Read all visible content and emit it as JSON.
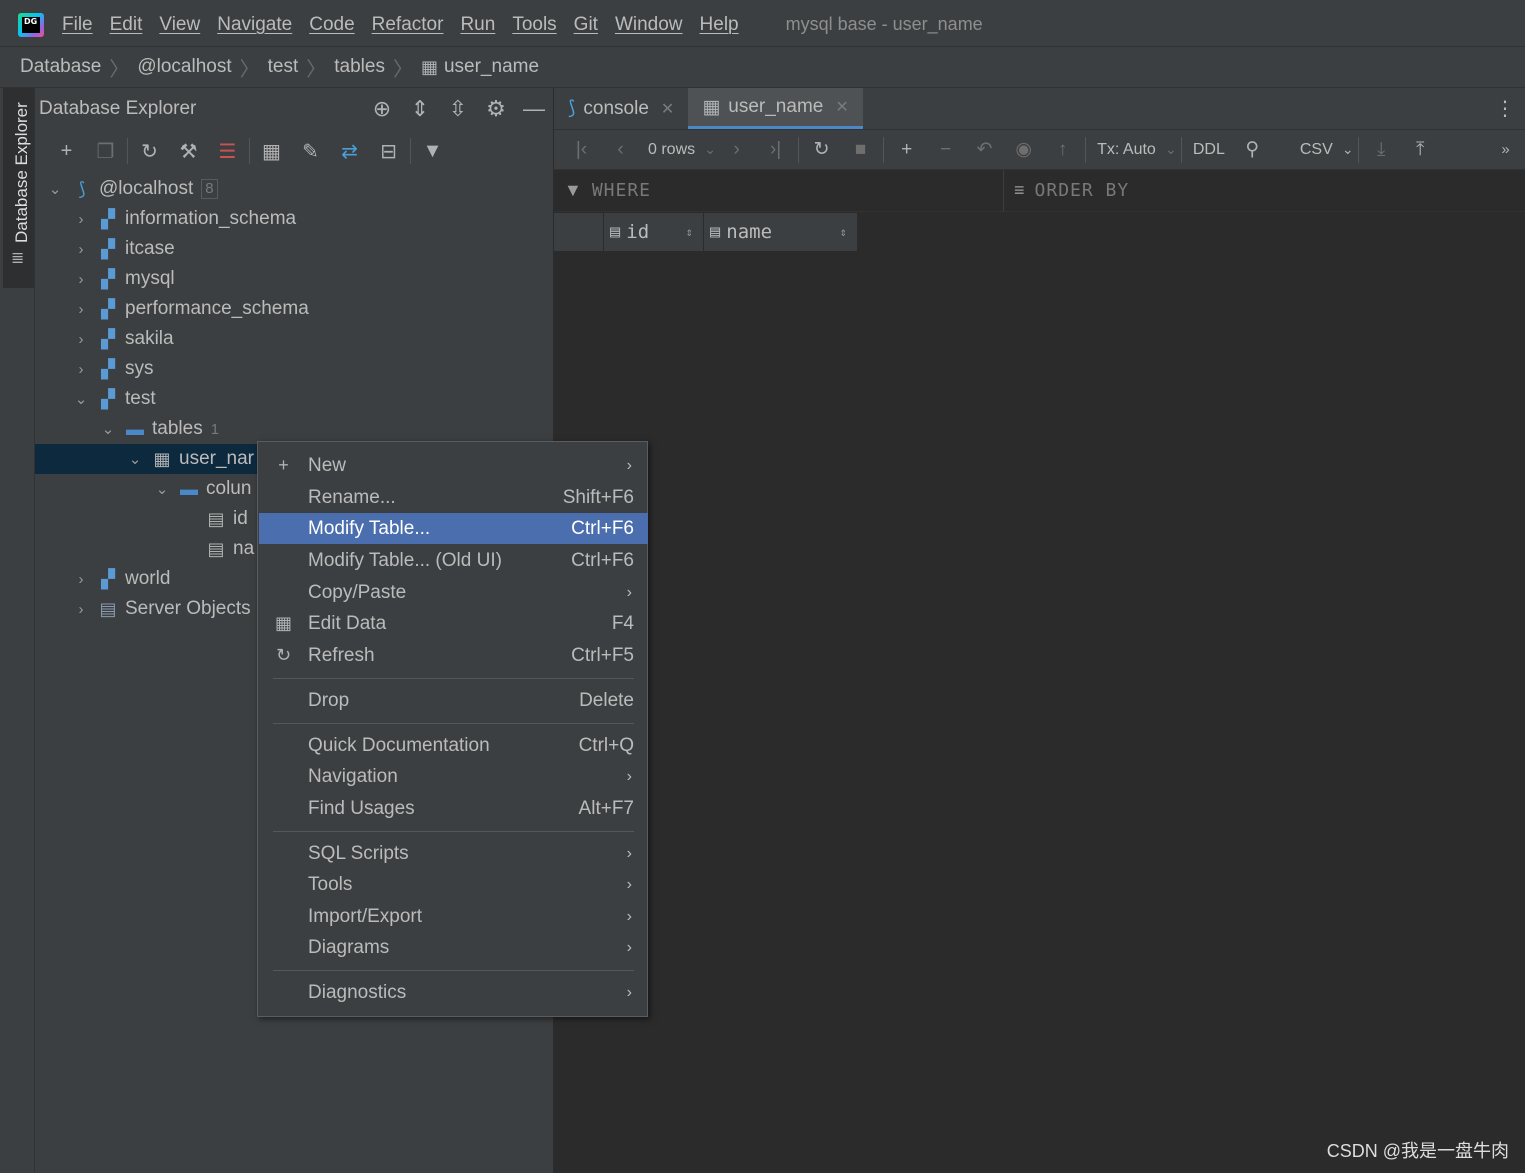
{
  "app": {
    "logo_text": "DG",
    "menu": [
      "File",
      "Edit",
      "View",
      "Navigate",
      "Code",
      "Refactor",
      "Run",
      "Tools",
      "Git",
      "Window",
      "Help"
    ],
    "window_title": "mysql base - user_name"
  },
  "breadcrumb": [
    "Database",
    "@localhost",
    "test",
    "tables",
    "user_name"
  ],
  "left_strip": {
    "tab_label": "Database Explorer"
  },
  "explorer": {
    "title": "Database Explorer",
    "tree": [
      {
        "label": "@localhost",
        "count": "8"
      },
      {
        "label": "information_schema"
      },
      {
        "label": "itcase"
      },
      {
        "label": "mysql"
      },
      {
        "label": "performance_schema"
      },
      {
        "label": "sakila"
      },
      {
        "label": "sys"
      },
      {
        "label": "test"
      },
      {
        "label": "tables",
        "count": "1"
      },
      {
        "label": "user_nar"
      },
      {
        "label": "colun"
      },
      {
        "label": "id"
      },
      {
        "label": "na"
      },
      {
        "label": "world"
      },
      {
        "label": "Server Objects"
      }
    ]
  },
  "editor": {
    "tabs": [
      {
        "label": "console"
      },
      {
        "label": "user_name"
      }
    ],
    "toolbar": {
      "rows": "0 rows",
      "tx": "Tx: Auto",
      "ddl": "DDL",
      "csv": "CSV"
    },
    "filter": {
      "where": "WHERE",
      "order_by": "ORDER BY"
    },
    "columns": [
      "id",
      "name"
    ]
  },
  "context_menu": {
    "items": [
      {
        "label": "New",
        "shortcut": "",
        "submenu": true
      },
      {
        "label": "Rename...",
        "shortcut": "Shift+F6"
      },
      {
        "label": "Modify Table...",
        "shortcut": "Ctrl+F6",
        "active": true
      },
      {
        "label": "Modify Table... (Old UI)",
        "shortcut": "Ctrl+F6"
      },
      {
        "label": "Copy/Paste",
        "shortcut": "",
        "submenu": true
      },
      {
        "label": "Edit Data",
        "shortcut": "F4"
      },
      {
        "label": "Refresh",
        "shortcut": "Ctrl+F5"
      },
      {
        "label": "Drop",
        "shortcut": "Delete"
      },
      {
        "label": "Quick Documentation",
        "shortcut": "Ctrl+Q"
      },
      {
        "label": "Navigation",
        "shortcut": "",
        "submenu": true
      },
      {
        "label": "Find Usages",
        "shortcut": "Alt+F7"
      },
      {
        "label": "SQL Scripts",
        "shortcut": "",
        "submenu": true
      },
      {
        "label": "Tools",
        "shortcut": "",
        "submenu": true
      },
      {
        "label": "Import/Export",
        "shortcut": "",
        "submenu": true
      },
      {
        "label": "Diagrams",
        "shortcut": "",
        "submenu": true
      },
      {
        "label": "Diagnostics",
        "shortcut": "",
        "submenu": true
      }
    ]
  },
  "watermark": "CSDN @我是一盘牛肉",
  "colors": {
    "accent": "#4b6eaf",
    "selection": "#0d293e",
    "background": "#2b2b2b",
    "panel": "#3c3f41"
  }
}
